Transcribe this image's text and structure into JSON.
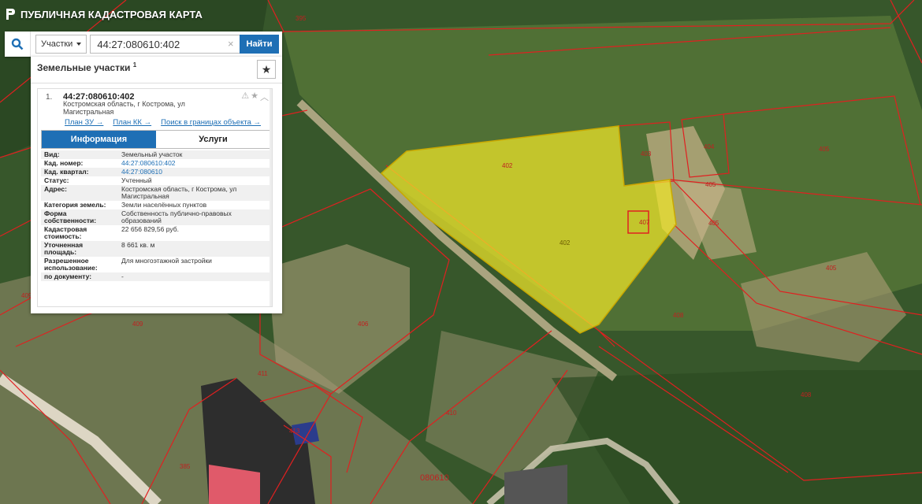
{
  "header": {
    "title": "ПУБЛИЧНАЯ КАДАСТРОВАЯ КАРТА"
  },
  "search": {
    "type_label": "Участки",
    "value": "44:27:080610:402",
    "button": "Найти"
  },
  "panel": {
    "title": "Земельные участки",
    "count": "1",
    "record": {
      "index": "1.",
      "cad_number": "44:27:080610:402",
      "address": "Костромская область, г Кострома, ул Магистральная",
      "links": [
        "План ЗУ →",
        "План КК →",
        "Поиск в границах объекта →"
      ]
    },
    "tabs": {
      "info": "Информация",
      "services": "Услуги"
    },
    "attributes": [
      {
        "key": "Вид:",
        "value": "Земельный участок"
      },
      {
        "key": "Кад. номер:",
        "value": "44:27:080610:402"
      },
      {
        "key": "Кад. квартал:",
        "value": "44:27:080610"
      },
      {
        "key": "Статус:",
        "value": "Учтенный"
      },
      {
        "key": "Адрес:",
        "value": "Костромская область, г Кострома, ул Магистральная"
      },
      {
        "key": "Категория земель:",
        "value": "Земли населённых пунктов"
      },
      {
        "key": "Форма собственности:",
        "value": "Собственность публично-правовых образований"
      },
      {
        "key": "Кадастровая стоимость:",
        "value": "22 656 829,56 руб."
      },
      {
        "key": "Уточненная площадь:",
        "value": "8 661 кв. м"
      },
      {
        "key": "Разрешенное использование:",
        "value": "Для многоэтажной застройки"
      },
      {
        "key": "по документу:",
        "value": "-"
      }
    ]
  },
  "map": {
    "parcel_labels": [
      "395",
      "402",
      "403",
      "404",
      "405",
      "405",
      "405",
      "405",
      "407",
      "408",
      "408",
      "409",
      "409",
      "410",
      "411",
      "413",
      "385",
      "406"
    ],
    "quarter_label": "080610",
    "colors": {
      "selected_fill": "#f0e62a",
      "boundary": "#e02020",
      "imagery": "#3f5e2e"
    }
  }
}
